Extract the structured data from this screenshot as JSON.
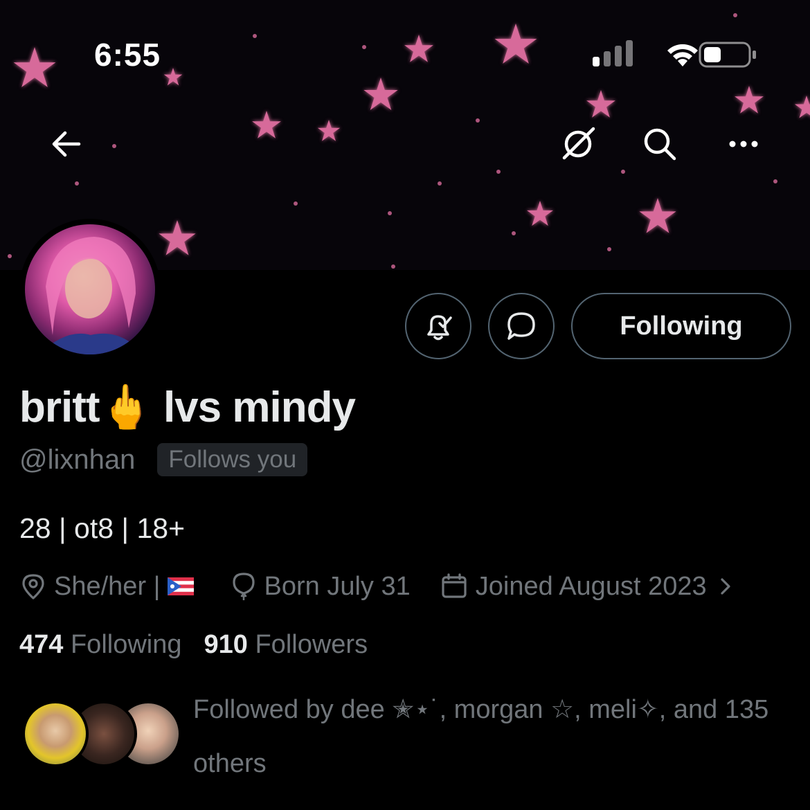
{
  "status_bar": {
    "time": "6:55"
  },
  "header": {
    "back_icon": "arrow-left-icon",
    "grok_icon": "grok-icon",
    "search_icon": "search-icon",
    "more_icon": "more-horizontal-icon"
  },
  "profile": {
    "display_name": "britt🖕 lvs mindy",
    "handle": "@lixnhan",
    "follows_you": "Follows you",
    "bio": "28 | ot8 | 18+",
    "pronouns": "She/her |",
    "birthday": "Born July 31",
    "joined": "Joined August 2023",
    "following_count": "474",
    "following_label": "Following",
    "followers_count": "910",
    "followers_label": "Followers",
    "followed_by": "Followed by dee ✭⋆˙, morgan ☆, meli✧, and 135 others"
  },
  "actions": {
    "following_button": "Following"
  },
  "colors": {
    "background": "#000000",
    "text_primary": "#e7e9ea",
    "text_secondary": "#71767b",
    "button_border": "#536471",
    "star_pink": "#d76a9a"
  }
}
